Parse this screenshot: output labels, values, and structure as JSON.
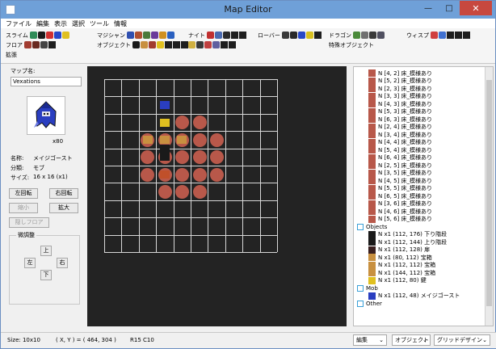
{
  "window": {
    "title": "Map Editor",
    "minimize": "—",
    "maximize": "□",
    "close": "✕"
  },
  "menu": [
    "ファイル",
    "編集",
    "表示",
    "選択",
    "ツール",
    "情報"
  ],
  "toolbar": {
    "slime": "スライム",
    "floor": "フロア",
    "extension": "拡張",
    "magician": "マジシャン",
    "object": "オブジェクト",
    "knight": "ナイト",
    "robber": "ローバー",
    "dragon": "ドラゴン",
    "special_object": "特殊オブジェクト",
    "wisp": "ウィスプ"
  },
  "left": {
    "map_name_label": "マップ名:",
    "map_name_value": "Vexations",
    "count": "x80",
    "name_label": "名称:",
    "name_value": "メイジゴースト",
    "category_label": "分類:",
    "category_value": "モブ",
    "size_label": "サイズ:",
    "size_value": "16 x 16 (x1)",
    "rotate_left": "左回転",
    "rotate_right": "右回転",
    "shrink": "縮小",
    "enlarge": "拡大",
    "hidden_floor": "隠しフロア",
    "fine_adjust": "微調整",
    "up": "上",
    "left": "左",
    "right": "右",
    "down": "下"
  },
  "tree": {
    "floor_rows": [
      "N [4, 2] 床_模様あり",
      "N [5, 2] 床_模様あり",
      "N [2, 3] 床_模様あり",
      "N [3, 3] 床_模様あり",
      "N [4, 3] 床_模様あり",
      "N [5, 3] 床_模様あり",
      "N [6, 3] 床_模様あり",
      "N [2, 4] 床_模様あり",
      "N [3, 4] 床_模様あり",
      "N [4, 4] 床_模様あり",
      "N [5, 4] 床_模様あり",
      "N [6, 4] 床_模様あり",
      "N [2, 5] 床_模様あり",
      "N [3, 5] 床_模様あり",
      "N [4, 5] 床_模様あり",
      "N [5, 5] 床_模様あり",
      "N [6, 5] 床_模様あり",
      "N [3, 6] 床_模様あり",
      "N [4, 6] 床_模様あり",
      "N [5, 6] 床_模様あり"
    ],
    "objects_label": "Objects",
    "object_rows": [
      "N x1 (112, 176) 下り階段",
      "N x1 (112, 144) 上り階段",
      "N x1 (112, 128) 扉",
      "N x1 (80, 112) 宝箱",
      "N x1 (112, 112) 宝箱",
      "N x1 (144, 112) 宝箱",
      "N x1 (112, 80) 鍵"
    ],
    "mob_label": "Mob",
    "mob_row": "N x1 (112, 48) メイジゴースト",
    "other_label": "Other"
  },
  "status": {
    "size": "Size: 10x10",
    "coords": "( X, Y ) = ( 464, 304 )",
    "cell": "R15 C10",
    "select_edit": "編集",
    "select_object": "オブジェクト",
    "select_design": "グリッドデザイン"
  },
  "colors": {
    "floor": "#b8584a",
    "accent": "#6fa0d8"
  }
}
